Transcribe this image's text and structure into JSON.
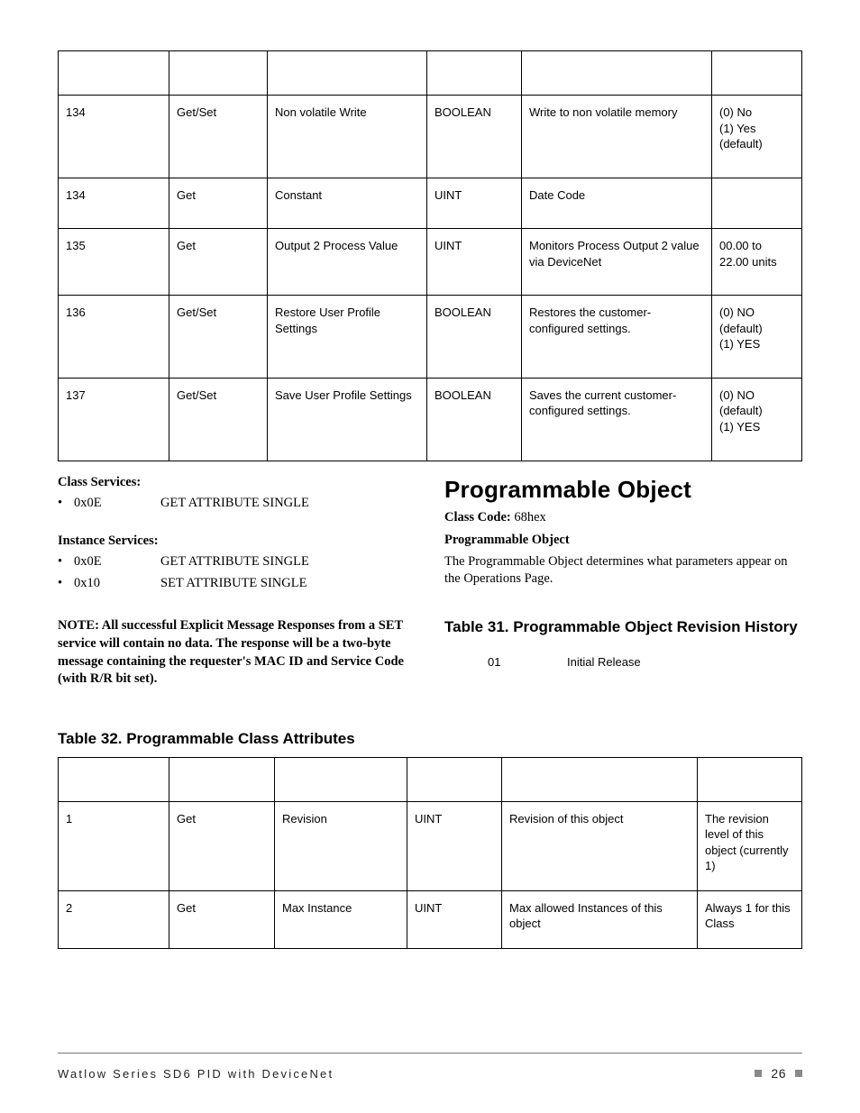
{
  "table_top": {
    "rows": [
      {
        "attr": "134",
        "access": "Get/Set",
        "name": "Non volatile Write",
        "type": "BOOLEAN",
        "desc": "Write to non volatile memory",
        "range": "(0) No\n(1) Yes (default)"
      },
      {
        "attr": "134",
        "access": "Get",
        "name": "Constant",
        "type": "UINT",
        "desc": "Date Code",
        "range": ""
      },
      {
        "attr": "135",
        "access": "Get",
        "name": "Output 2 Process Value",
        "type": "UINT",
        "desc": "Monitors Process Output 2 value via DeviceNet",
        "range": "00.00 to 22.00 units"
      },
      {
        "attr": "136",
        "access": "Get/Set",
        "name": "Restore User Profile Settings",
        "type": "BOOLEAN",
        "desc": "Restores the customer-configured settings.",
        "range": "(0) NO (default)\n(1) YES"
      },
      {
        "attr": "137",
        "access": "Get/Set",
        "name": "Save User Profile Settings",
        "type": "BOOLEAN",
        "desc": "Saves the current customer-configured settings.",
        "range": "(0) NO (default)\n(1) YES"
      }
    ]
  },
  "left": {
    "class_services_label": "Class Services:",
    "class_services": [
      {
        "code": "0x0E",
        "name": "GET ATTRIBUTE SINGLE"
      }
    ],
    "instance_services_label": "Instance Services:",
    "instance_services": [
      {
        "code": "0x0E",
        "name": "GET ATTRIBUTE SINGLE"
      },
      {
        "code": "0x10",
        "name": "SET ATTRIBUTE SINGLE"
      }
    ],
    "note": "NOTE: All successful Explicit Message Responses from a SET service will contain no data. The response will be a two-byte message containing the requester's MAC ID and Service Code (with R/R bit set)."
  },
  "right": {
    "heading": "Programmable Object",
    "class_code_label": "Class Code:",
    "class_code_value": " 68hex",
    "sub": "Programmable Object",
    "desc": "The Programmable Object determines what parameters appear on the Operations Page.",
    "table31_title": "Table 31. Programmable Object Revision History",
    "rev_code": "01",
    "rev_text": "Initial Release"
  },
  "table32_title": "Table 32. Programmable Class Attributes",
  "table_bottom": {
    "rows": [
      {
        "attr": "1",
        "access": "Get",
        "name": "Revision",
        "type": "UINT",
        "desc": "Revision of this object",
        "range": "The revision level of this object (currently 1)"
      },
      {
        "attr": "2",
        "access": "Get",
        "name": "Max Instance",
        "type": "UINT",
        "desc": "Max allowed Instances of this object",
        "range": "Always 1 for this Class"
      }
    ]
  },
  "footer": {
    "left": "Watlow Series SD6 PID with DeviceNet",
    "page": "26"
  }
}
